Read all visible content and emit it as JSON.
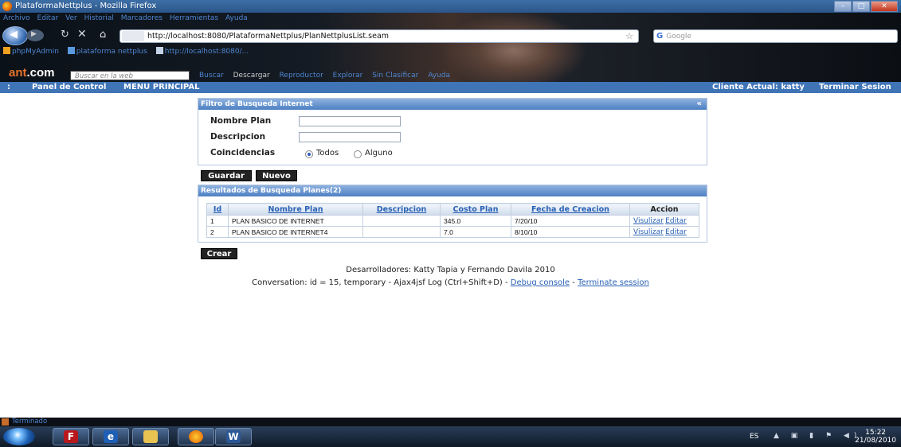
{
  "window": {
    "title": "PlataformaNettplus - Mozilla Firefox",
    "buttons": [
      "–",
      "□",
      "✕"
    ]
  },
  "menubar": [
    "Archivo",
    "Editar",
    "Ver",
    "Historial",
    "Marcadores",
    "Herramientas",
    "Ayuda"
  ],
  "navigation": {
    "url": "http://localhost:8080/PlataformaNettplus/PlanNettplusList.seam",
    "search_engine": "Google",
    "search_placeholder": "Google"
  },
  "bookmarks": [
    "phpMyAdmin",
    "plataforma nettplus",
    "http://localhost:8080/..."
  ],
  "ask_toolbar": {
    "logo_a": "ant",
    "logo_b": ".com",
    "search_placeholder": "Buscar en la web",
    "tools": [
      "Buscar",
      "Descargar",
      "Reproductor",
      "Explorar",
      "Sin Clasificar",
      "Ayuda"
    ]
  },
  "page_header": {
    "sep": ":",
    "panel": "Panel de Control",
    "menu": "MENU PRINCIPAL",
    "client": "Cliente Actual: katty",
    "logout": "Terminar Sesion"
  },
  "filter_panel": {
    "title": "Filtro de Busqueda Internet",
    "collapse": "«",
    "fields": {
      "name_label": "Nombre Plan",
      "name_value": "",
      "desc_label": "Descripcion",
      "desc_value": "",
      "match_label": "Coincidencias"
    },
    "match_options": [
      "Todos",
      "Alguno"
    ],
    "match_selected": "Todos"
  },
  "buttons": {
    "save": "Guardar",
    "new": "Nuevo",
    "create": "Crear"
  },
  "results_panel": {
    "title": "Resultados de Busqueda Planes(2)",
    "columns": [
      "Id",
      "Nombre Plan",
      "Descripcion",
      "Costo Plan",
      "Fecha de Creacion",
      "Accion"
    ],
    "rows": [
      {
        "id": "1",
        "name": "PLAN BASICO DE INTERNET",
        "desc": "",
        "cost": "345.0",
        "date": "7/20/10",
        "view": "Visulizar",
        "edit": "Editar"
      },
      {
        "id": "2",
        "name": "PLAN BASICO DE INTERNET4",
        "desc": "",
        "cost": "7.0",
        "date": "8/10/10",
        "view": "Visulizar",
        "edit": "Editar"
      }
    ]
  },
  "footer": {
    "developers": "Desarrolladores: Katty Tapia y Fernando Davila 2010",
    "conversation": "Conversation: id = 15, temporary - Ajax4jsf Log (Ctrl+Shift+D) -",
    "sep": "-",
    "debug_link": "Debug console",
    "terminate_link": "Terminate session"
  },
  "statusbar": {
    "text": "Terminado"
  },
  "taskbar": {
    "apps": [
      "FileZilla",
      "Explorer",
      "Folder",
      "Firefox",
      "Word"
    ],
    "lang": "ES",
    "time": "15:22",
    "date": "21/08/2010"
  },
  "colors": {
    "accent": "#3f74b7",
    "link": "#2a62b5",
    "header_grad": "#4d80c2"
  }
}
